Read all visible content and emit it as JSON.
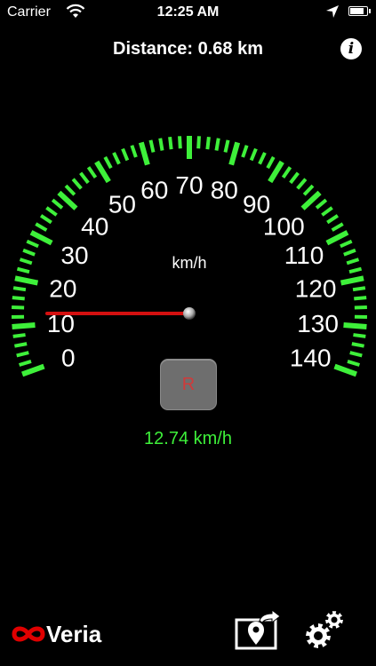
{
  "status_bar": {
    "carrier": "Carrier",
    "time": "12:25 AM",
    "battery_level": 0.9
  },
  "header": {
    "distance": "Distance: 0.68 km"
  },
  "info_button": {
    "label": "i"
  },
  "gauge": {
    "unit_label": "km/h",
    "min": 0,
    "max": 140,
    "major_step": 10,
    "tick_labels": [
      "0",
      "10",
      "20",
      "30",
      "40",
      "50",
      "60",
      "70",
      "80",
      "90",
      "100",
      "110",
      "120",
      "130",
      "140"
    ],
    "current_speed": 12.74,
    "tick_color": "#3ef03a",
    "needle_color": "#d41010"
  },
  "reset_button": {
    "label": "R"
  },
  "speed_readout": {
    "text": "12.74 km/h",
    "color": "#3ef03a"
  },
  "footer": {
    "brand": "Veria",
    "brand_icon": "infinity-icon",
    "share_icon": "map-share-icon",
    "settings_icon": "gears-icon",
    "accent": "#e00000"
  }
}
